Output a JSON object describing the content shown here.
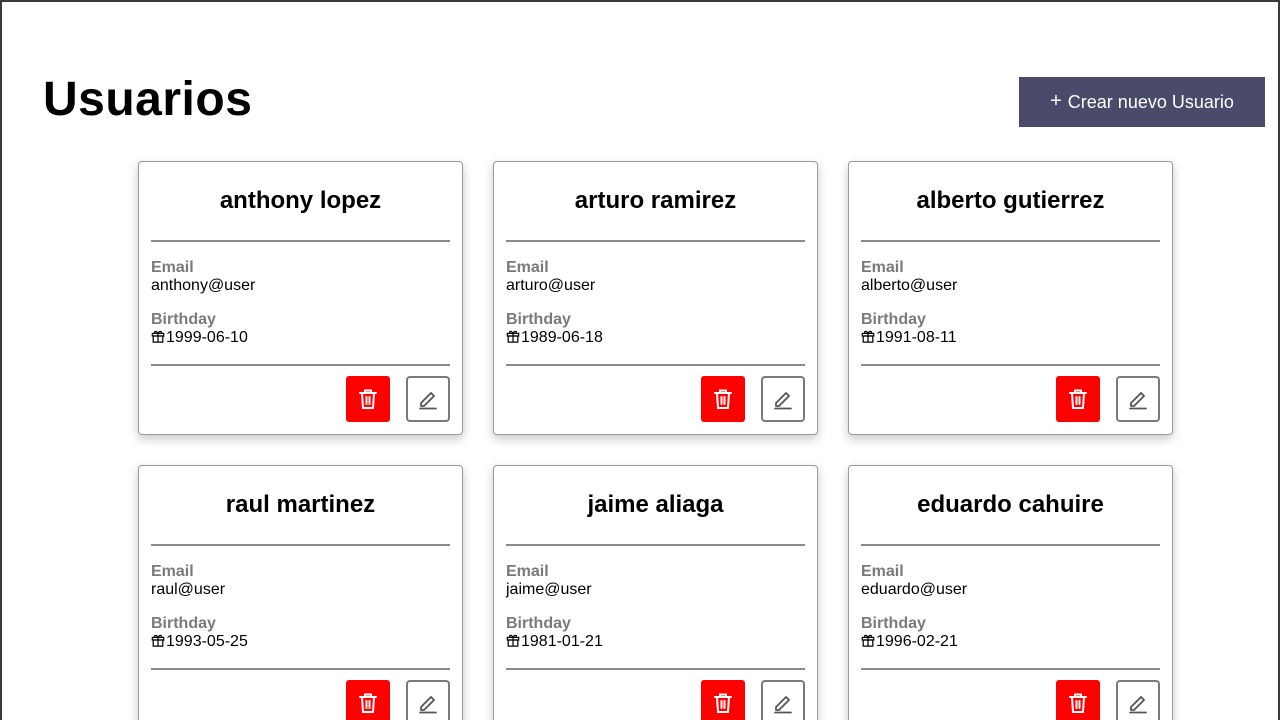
{
  "page": {
    "title": "Usuarios",
    "create_button": {
      "icon": "plus-icon",
      "label": "Crear nuevo Usuario"
    }
  },
  "labels": {
    "email": "Email",
    "birthday": "Birthday"
  },
  "colors": {
    "create_button": "#4a4a6a",
    "delete_button": "#ff0000",
    "label_gray": "#7a7a7a"
  },
  "users": [
    {
      "name": "anthony lopez",
      "email": "anthony@user",
      "birthday": "1999-06-10"
    },
    {
      "name": "arturo ramirez",
      "email": "arturo@user",
      "birthday": "1989-06-18"
    },
    {
      "name": "alberto gutierrez",
      "email": "alberto@user",
      "birthday": "1991-08-11"
    },
    {
      "name": "raul martinez",
      "email": "raul@user",
      "birthday": "1993-05-25"
    },
    {
      "name": "jaime aliaga",
      "email": "jaime@user",
      "birthday": "1981-01-21"
    },
    {
      "name": "eduardo cahuire",
      "email": "eduardo@user",
      "birthday": "1996-02-21"
    }
  ]
}
